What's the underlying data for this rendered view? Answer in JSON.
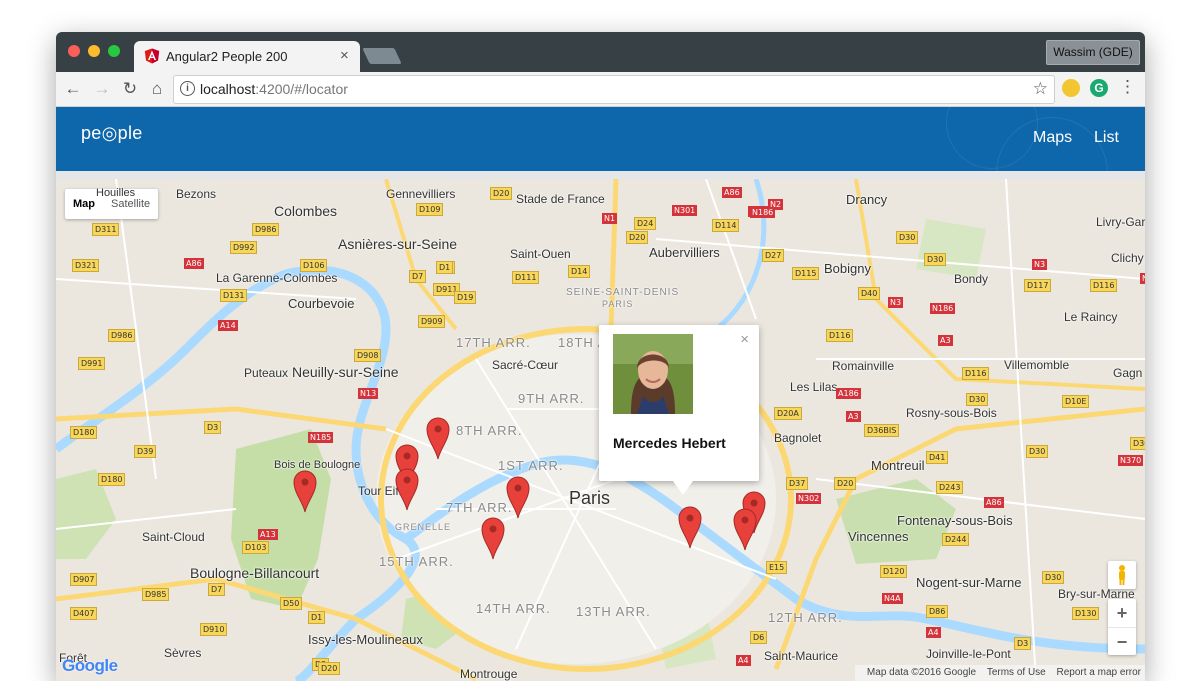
{
  "browser": {
    "tab_title": "Angular2 People 200",
    "tab_close": "×",
    "profile_name": "Wassim (GDE)",
    "url_host": "localhost",
    "url_path": ":4200/#/locator",
    "ext_g_label": "G",
    "icons": [
      "back-icon",
      "forward-icon",
      "reload-icon",
      "home-icon",
      "info-icon",
      "star-icon",
      "menu-icon"
    ]
  },
  "app": {
    "logo_text": "pe◎ple",
    "nav": {
      "maps": "Maps",
      "list": "List"
    },
    "brand_color": "#0f67ab"
  },
  "map": {
    "type_control": {
      "map": "Map",
      "satellite": "Satellite"
    },
    "zoom": {
      "in": "+",
      "out": "−"
    },
    "google_logo": "Google",
    "attribution": {
      "data": "Map data ©2016 Google",
      "terms": "Terms of Use",
      "report": "Report a map error"
    },
    "place_labels": [
      "Houilles",
      "Bezons",
      "Gennevilliers",
      "Stade de France",
      "Drancy",
      "Livry-Gar",
      "Colombes",
      "Asnières-sur-Seine",
      "Saint-Ouen",
      "Aubervilliers",
      "Bobigny",
      "Bondy",
      "Clichy",
      "La Garenne-Colombes",
      "SEINE-SAINT-DENIS",
      "PARIS",
      "Courbevoie",
      "Le Raincy",
      "17TH ARR.",
      "18TH ARR.",
      "Sacré-Cœur",
      "Romainville",
      "Villemomble",
      "Gagn",
      "Puteaux",
      "Neuilly-sur-Seine",
      "Les Lilas",
      "9TH ARR.",
      "Rosny-sous-Bois",
      "8TH ARR.",
      "Bagnolet",
      "Montreuil",
      "Bois de Boulogne",
      "1ST ARR.",
      "Tour Eiffel",
      "Paris",
      "7TH ARR.",
      "Fontenay-sous-Bois",
      "GRENELLE",
      "Saint-Cloud",
      "Vincennes",
      "15TH ARR.",
      "Boulogne-Billancourt",
      "Nogent-sur-Marne",
      "Bry-sur-Marne",
      "14TH ARR.",
      "13TH ARR.",
      "12TH ARR.",
      "Issy-les-Moulineaux",
      "Sèvres",
      "Saint-Maurice",
      "Joinville-le-Pont",
      "Montrouge",
      "Forêt"
    ],
    "road_labels": [
      "D311",
      "D986",
      "D992",
      "D321",
      "A86",
      "D106",
      "D131",
      "A14",
      "D986",
      "D991",
      "D180",
      "D39",
      "D180",
      "D3",
      "N185",
      "A13",
      "D103",
      "D907",
      "D985",
      "D7",
      "D407",
      "D910",
      "D50",
      "D1",
      "D2",
      "D7",
      "D911",
      "D19",
      "D1",
      "D909",
      "D908",
      "N13",
      "D20",
      "D109",
      "D1",
      "D14",
      "D111",
      "N1",
      "D24",
      "D20",
      "D114",
      "N301",
      "N186",
      "A86",
      "N2",
      "N186",
      "D27",
      "D115",
      "D30",
      "D30",
      "N3",
      "D40",
      "N3",
      "D117",
      "D116",
      "N40",
      "A3",
      "D116",
      "N186",
      "D116",
      "D30",
      "D10E",
      "D20A",
      "A3",
      "A186",
      "D36BIS",
      "D41",
      "D30",
      "N370",
      "D301",
      "D37",
      "D20",
      "N302",
      "D243",
      "A86",
      "E15",
      "D244",
      "D120",
      "N4A",
      "D86",
      "D30",
      "D130",
      "A4",
      "D6",
      "D3",
      "A4",
      "D20",
      "D202"
    ],
    "markers": 9
  },
  "popup": {
    "name": "Mercedes Hebert",
    "close": "×"
  }
}
